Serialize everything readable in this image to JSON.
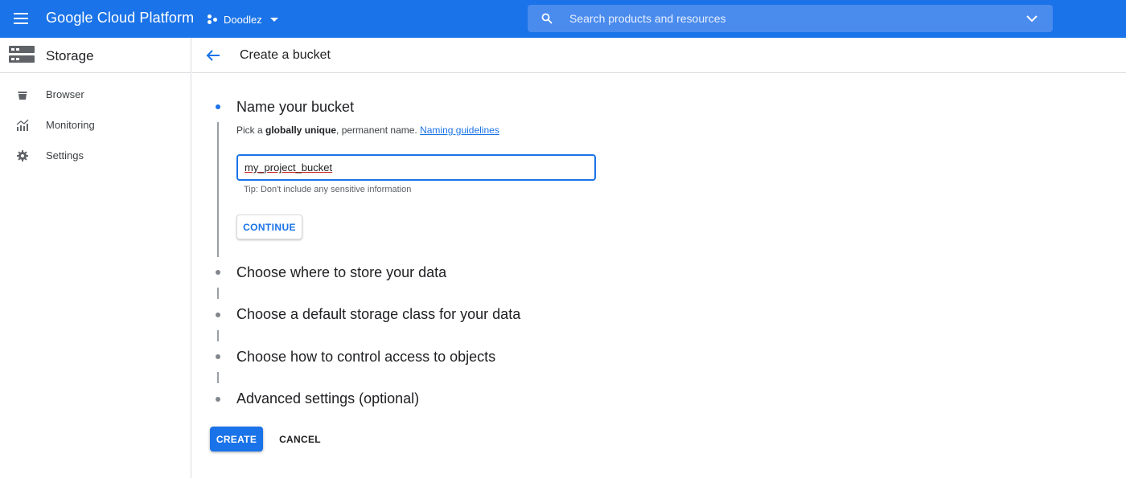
{
  "topbar": {
    "brand": "Google Cloud Platform",
    "project": "Doodlez",
    "search_placeholder": "Search products and resources",
    "accent_color": "#1a73e8"
  },
  "sidebar": {
    "title": "Storage",
    "items": [
      {
        "label": "Browser",
        "icon": "bucket-icon"
      },
      {
        "label": "Monitoring",
        "icon": "monitoring-chart-icon"
      },
      {
        "label": "Settings",
        "icon": "gear-icon"
      }
    ]
  },
  "page": {
    "title": "Create a bucket"
  },
  "steps": [
    {
      "title": "Name your bucket",
      "active": true
    },
    {
      "title": "Choose where to store your data",
      "active": false
    },
    {
      "title": "Choose a default storage class for your data",
      "active": false
    },
    {
      "title": "Choose how to control access to objects",
      "active": false
    },
    {
      "title": "Advanced settings (optional)",
      "active": false
    }
  ],
  "name_step": {
    "hint_prefix": "Pick a ",
    "hint_bold": "globally unique",
    "hint_suffix": ", permanent name. ",
    "hint_link": "Naming guidelines",
    "input_value": "my_project_bucket",
    "tip": "Tip: Don't include any sensitive information",
    "continue_label": "CONTINUE"
  },
  "actions": {
    "create_label": "CREATE",
    "cancel_label": "CANCEL"
  }
}
